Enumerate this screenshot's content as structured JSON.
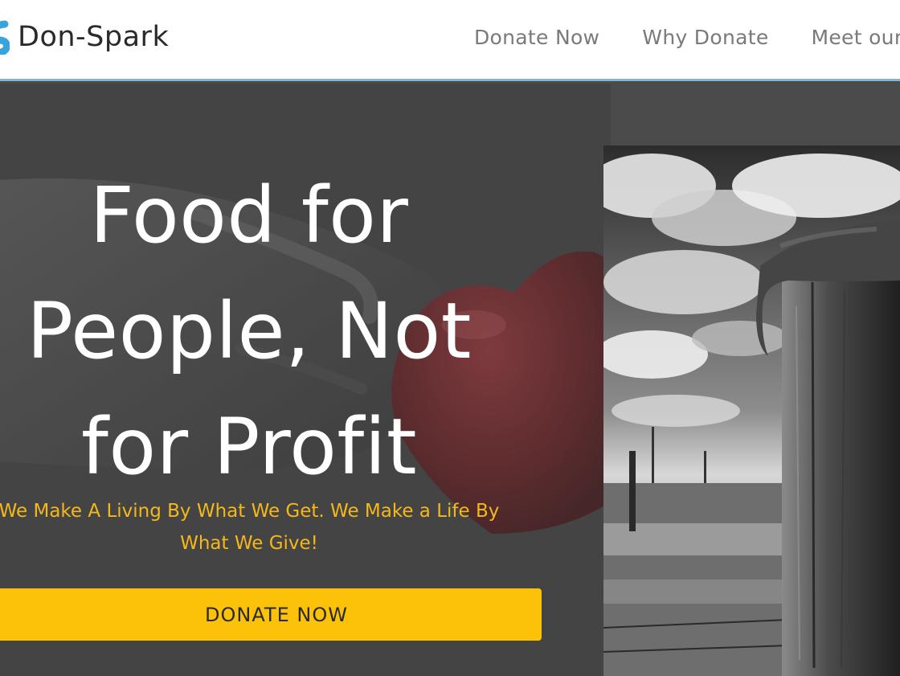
{
  "navbar": {
    "brand_name": "Don-Spark",
    "links": [
      "Donate Now",
      "Why Donate",
      "Meet our"
    ]
  },
  "hero": {
    "title_lines": [
      "Food for",
      "People, Not",
      "for Profit"
    ],
    "tagline_lines": [
      "We Make A Living By What We Get. We Make a Life By",
      "What We Give!"
    ],
    "cta_label": "DONATE NOW"
  },
  "colors": {
    "accent": "#fcc109",
    "tagline": "#f4b81a",
    "hero_bg": "#4b4b4b",
    "navbar_border": "#7fb7d2",
    "logo": "#3aa3dc"
  },
  "icons": {
    "brand_logo": "brand-logo-icon"
  },
  "images": {
    "hero_background": "hand holding red heart (black and white)",
    "hero_photo": "black and white photo of a hand resting on a wooden fence post under a cloudy sky"
  }
}
